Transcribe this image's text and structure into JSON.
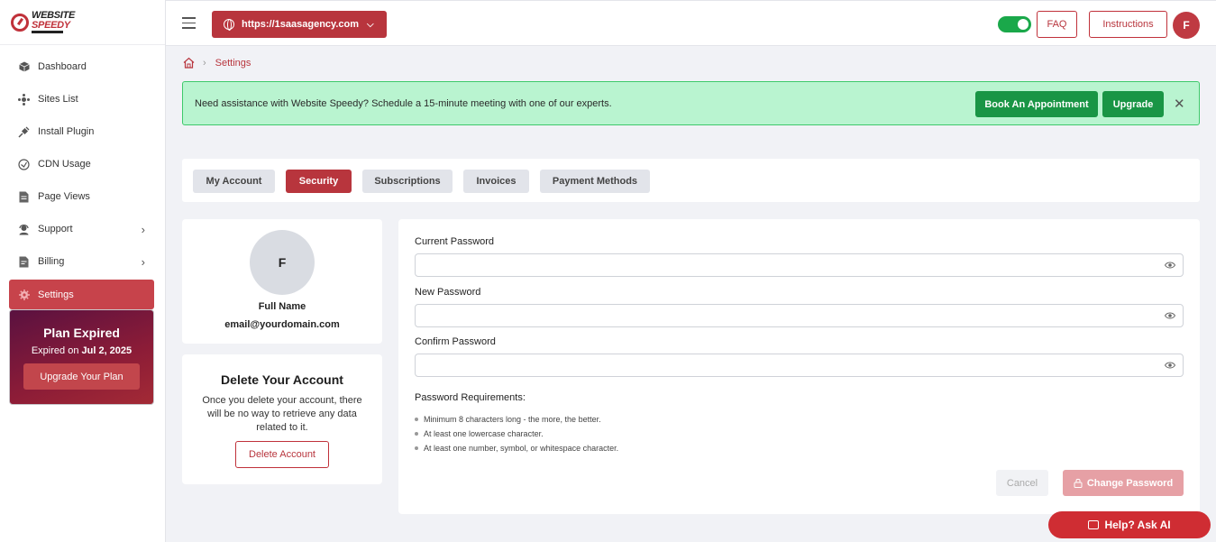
{
  "logo": {
    "line1": "WEBSITE",
    "line2": "SPEEDY"
  },
  "sidebar": {
    "items": [
      {
        "label": "Dashboard",
        "icon": "cube-icon"
      },
      {
        "label": "Sites List",
        "icon": "sites-icon"
      },
      {
        "label": "Install Plugin",
        "icon": "plug-icon"
      },
      {
        "label": "CDN Usage",
        "icon": "cdn-icon"
      },
      {
        "label": "Page Views",
        "icon": "page-icon"
      },
      {
        "label": "Support",
        "icon": "support-icon"
      },
      {
        "label": "Billing",
        "icon": "billing-icon"
      },
      {
        "label": "Settings",
        "icon": "gear-icon"
      }
    ],
    "plan": {
      "title": "Plan Expired",
      "expired_prefix": "Expired on ",
      "expired_date": "Jul 2, 2025",
      "button": "Upgrade Your Plan"
    }
  },
  "header": {
    "url": "https://1saasagency.com",
    "faq": "FAQ",
    "instructions": "Instructions",
    "avatar_initial": "F"
  },
  "breadcrumb": {
    "current": "Settings"
  },
  "alert": {
    "text": "Need assistance with Website Speedy? Schedule a 15-minute meeting with one of our experts.",
    "book_button": "Book An Appointment",
    "upgrade_button": "Upgrade"
  },
  "tabs": [
    "My Account",
    "Security",
    "Subscriptions",
    "Invoices",
    "Payment Methods"
  ],
  "profile": {
    "initial": "F",
    "name": "Full Name",
    "email": "email@yourdomain.com"
  },
  "delete_account": {
    "title": "Delete Your Account",
    "text": "Once you delete your account, there will be no way to retrieve any data related to it.",
    "button": "Delete Account"
  },
  "password_form": {
    "current_label": "Current Password",
    "new_label": "New Password",
    "confirm_label": "Confirm Password",
    "current_value": "",
    "new_value": "",
    "confirm_value": "",
    "requirements_title": "Password Requirements:",
    "requirements": [
      "Minimum 8 characters long - the more, the better.",
      "At least one lowercase character.",
      "At least one number, symbol, or whitespace character."
    ],
    "cancel": "Cancel",
    "submit": "Change Password"
  },
  "help": {
    "label": "Help? Ask AI"
  },
  "colors": {
    "brand": "#b8353d",
    "success": "#199545",
    "alert_bg": "#b9f4d0",
    "toggle_on": "#1aa84a"
  }
}
